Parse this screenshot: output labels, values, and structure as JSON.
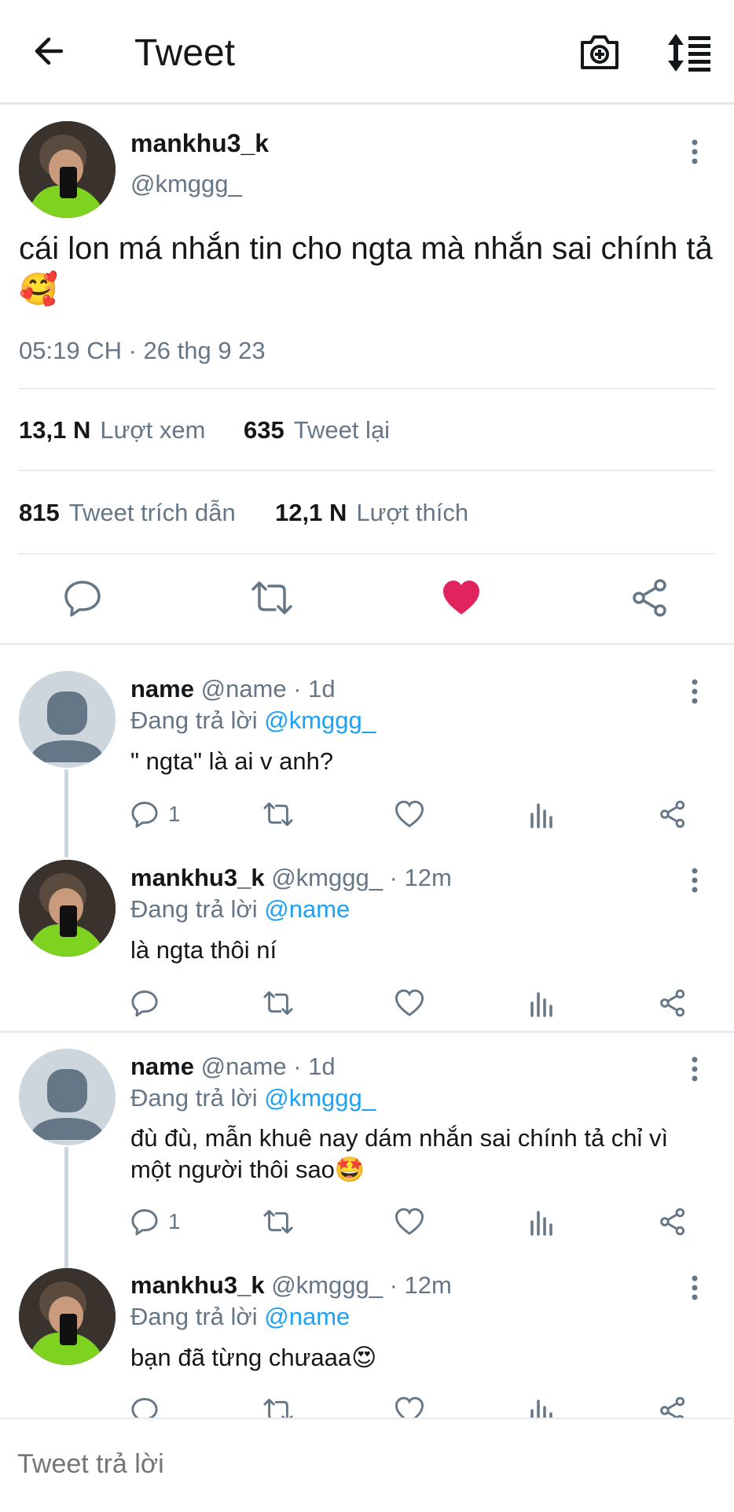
{
  "topbar": {
    "title": "Tweet",
    "back_icon": "arrow-left-icon",
    "camera_icon": "camera-plus-icon",
    "sort_icon": "sort-icon"
  },
  "tweet": {
    "name": "mankhu3_k",
    "handle": "@kmggg_",
    "text": "cái lon má nhắn tin cho ngta mà nhắn sai chính tả🥰",
    "timestamp": "05:19 CH · 26 thg 9 23",
    "stats": {
      "views_count": "13,1 N",
      "views_label": "Lượt xem",
      "retweets_count": "635",
      "retweets_label": "Tweet lại",
      "quotes_count": "815",
      "quotes_label": "Tweet trích dẫn",
      "likes_count": "12,1 N",
      "likes_label": "Lượt thích"
    },
    "liked": true,
    "like_color": "#e0245e"
  },
  "replies": [
    {
      "name": "name",
      "meta": "@name · 1d",
      "replying_prefix": "Đang trả lời",
      "mention": "@kmggg_",
      "text": "\" ngta\" là ai v anh?",
      "reply_count": "1"
    },
    {
      "name": "mankhu3_k",
      "meta": "@kmggg_ · 12m",
      "replying_prefix": "Đang trả lời",
      "mention": "@name",
      "text": "là ngta thôi ní",
      "reply_count": ""
    },
    {
      "name": "name",
      "meta": "@name · 1d",
      "replying_prefix": "Đang trả lời",
      "mention": "@kmggg_",
      "text": "đù đù, mẫn khuê nay dám nhắn sai chính tả chỉ vì một người thôi sao🤩",
      "reply_count": "1"
    },
    {
      "name": "mankhu3_k",
      "meta": "@kmggg_ · 12m",
      "replying_prefix": "Đang trả lời",
      "mention": "@name",
      "text": "bạn đã từng chưaaa😍",
      "reply_count": ""
    }
  ],
  "compose": {
    "placeholder": "Tweet trả lời"
  },
  "colors": {
    "accent": "#1da1f2",
    "muted": "#657786",
    "like": "#e0245e"
  }
}
